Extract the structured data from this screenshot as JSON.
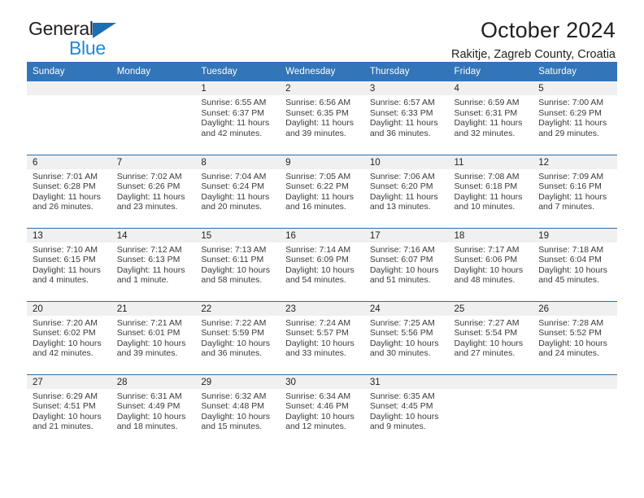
{
  "brand": {
    "name_line1": "General",
    "name_line2": "Blue",
    "triangle_color": "#1a6fb5",
    "blue_color": "#2089d6"
  },
  "header": {
    "month_title": "October 2024",
    "location": "Rakitje, Zagreb County, Croatia"
  },
  "calendar": {
    "header_bg": "#3275b8",
    "daynum_band_bg": "#f0f0f0",
    "row_separator_color": "#2d6ca8",
    "day_names": [
      "Sunday",
      "Monday",
      "Tuesday",
      "Wednesday",
      "Thursday",
      "Friday",
      "Saturday"
    ],
    "weeks": [
      [
        {
          "day": "",
          "empty": true,
          "lines": []
        },
        {
          "day": "",
          "empty": true,
          "lines": []
        },
        {
          "day": "1",
          "lines": [
            "Sunrise: 6:55 AM",
            "Sunset: 6:37 PM",
            "Daylight: 11 hours",
            "and 42 minutes."
          ]
        },
        {
          "day": "2",
          "lines": [
            "Sunrise: 6:56 AM",
            "Sunset: 6:35 PM",
            "Daylight: 11 hours",
            "and 39 minutes."
          ]
        },
        {
          "day": "3",
          "lines": [
            "Sunrise: 6:57 AM",
            "Sunset: 6:33 PM",
            "Daylight: 11 hours",
            "and 36 minutes."
          ]
        },
        {
          "day": "4",
          "lines": [
            "Sunrise: 6:59 AM",
            "Sunset: 6:31 PM",
            "Daylight: 11 hours",
            "and 32 minutes."
          ]
        },
        {
          "day": "5",
          "lines": [
            "Sunrise: 7:00 AM",
            "Sunset: 6:29 PM",
            "Daylight: 11 hours",
            "and 29 minutes."
          ]
        }
      ],
      [
        {
          "day": "6",
          "lines": [
            "Sunrise: 7:01 AM",
            "Sunset: 6:28 PM",
            "Daylight: 11 hours",
            "and 26 minutes."
          ]
        },
        {
          "day": "7",
          "lines": [
            "Sunrise: 7:02 AM",
            "Sunset: 6:26 PM",
            "Daylight: 11 hours",
            "and 23 minutes."
          ]
        },
        {
          "day": "8",
          "lines": [
            "Sunrise: 7:04 AM",
            "Sunset: 6:24 PM",
            "Daylight: 11 hours",
            "and 20 minutes."
          ]
        },
        {
          "day": "9",
          "lines": [
            "Sunrise: 7:05 AM",
            "Sunset: 6:22 PM",
            "Daylight: 11 hours",
            "and 16 minutes."
          ]
        },
        {
          "day": "10",
          "lines": [
            "Sunrise: 7:06 AM",
            "Sunset: 6:20 PM",
            "Daylight: 11 hours",
            "and 13 minutes."
          ]
        },
        {
          "day": "11",
          "lines": [
            "Sunrise: 7:08 AM",
            "Sunset: 6:18 PM",
            "Daylight: 11 hours",
            "and 10 minutes."
          ]
        },
        {
          "day": "12",
          "lines": [
            "Sunrise: 7:09 AM",
            "Sunset: 6:16 PM",
            "Daylight: 11 hours",
            "and 7 minutes."
          ]
        }
      ],
      [
        {
          "day": "13",
          "lines": [
            "Sunrise: 7:10 AM",
            "Sunset: 6:15 PM",
            "Daylight: 11 hours",
            "and 4 minutes."
          ]
        },
        {
          "day": "14",
          "lines": [
            "Sunrise: 7:12 AM",
            "Sunset: 6:13 PM",
            "Daylight: 11 hours",
            "and 1 minute."
          ]
        },
        {
          "day": "15",
          "lines": [
            "Sunrise: 7:13 AM",
            "Sunset: 6:11 PM",
            "Daylight: 10 hours",
            "and 58 minutes."
          ]
        },
        {
          "day": "16",
          "lines": [
            "Sunrise: 7:14 AM",
            "Sunset: 6:09 PM",
            "Daylight: 10 hours",
            "and 54 minutes."
          ]
        },
        {
          "day": "17",
          "lines": [
            "Sunrise: 7:16 AM",
            "Sunset: 6:07 PM",
            "Daylight: 10 hours",
            "and 51 minutes."
          ]
        },
        {
          "day": "18",
          "lines": [
            "Sunrise: 7:17 AM",
            "Sunset: 6:06 PM",
            "Daylight: 10 hours",
            "and 48 minutes."
          ]
        },
        {
          "day": "19",
          "lines": [
            "Sunrise: 7:18 AM",
            "Sunset: 6:04 PM",
            "Daylight: 10 hours",
            "and 45 minutes."
          ]
        }
      ],
      [
        {
          "day": "20",
          "lines": [
            "Sunrise: 7:20 AM",
            "Sunset: 6:02 PM",
            "Daylight: 10 hours",
            "and 42 minutes."
          ]
        },
        {
          "day": "21",
          "lines": [
            "Sunrise: 7:21 AM",
            "Sunset: 6:01 PM",
            "Daylight: 10 hours",
            "and 39 minutes."
          ]
        },
        {
          "day": "22",
          "lines": [
            "Sunrise: 7:22 AM",
            "Sunset: 5:59 PM",
            "Daylight: 10 hours",
            "and 36 minutes."
          ]
        },
        {
          "day": "23",
          "lines": [
            "Sunrise: 7:24 AM",
            "Sunset: 5:57 PM",
            "Daylight: 10 hours",
            "and 33 minutes."
          ]
        },
        {
          "day": "24",
          "lines": [
            "Sunrise: 7:25 AM",
            "Sunset: 5:56 PM",
            "Daylight: 10 hours",
            "and 30 minutes."
          ]
        },
        {
          "day": "25",
          "lines": [
            "Sunrise: 7:27 AM",
            "Sunset: 5:54 PM",
            "Daylight: 10 hours",
            "and 27 minutes."
          ]
        },
        {
          "day": "26",
          "lines": [
            "Sunrise: 7:28 AM",
            "Sunset: 5:52 PM",
            "Daylight: 10 hours",
            "and 24 minutes."
          ]
        }
      ],
      [
        {
          "day": "27",
          "lines": [
            "Sunrise: 6:29 AM",
            "Sunset: 4:51 PM",
            "Daylight: 10 hours",
            "and 21 minutes."
          ]
        },
        {
          "day": "28",
          "lines": [
            "Sunrise: 6:31 AM",
            "Sunset: 4:49 PM",
            "Daylight: 10 hours",
            "and 18 minutes."
          ]
        },
        {
          "day": "29",
          "lines": [
            "Sunrise: 6:32 AM",
            "Sunset: 4:48 PM",
            "Daylight: 10 hours",
            "and 15 minutes."
          ]
        },
        {
          "day": "30",
          "lines": [
            "Sunrise: 6:34 AM",
            "Sunset: 4:46 PM",
            "Daylight: 10 hours",
            "and 12 minutes."
          ]
        },
        {
          "day": "31",
          "lines": [
            "Sunrise: 6:35 AM",
            "Sunset: 4:45 PM",
            "Daylight: 10 hours",
            "and 9 minutes."
          ]
        },
        {
          "day": "",
          "empty": true,
          "lines": []
        },
        {
          "day": "",
          "empty": true,
          "lines": []
        }
      ]
    ]
  }
}
